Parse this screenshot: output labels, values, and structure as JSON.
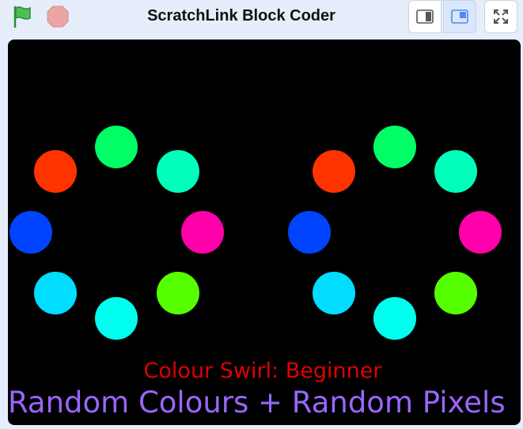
{
  "header": {
    "title": "ScratchLink Block Coder",
    "green_flag_icon": "green-flag-icon",
    "stop_icon": "stop-icon",
    "view_buttons": [
      {
        "name": "small-stage-button",
        "icon": "small-stage-icon"
      },
      {
        "name": "large-stage-button",
        "icon": "large-stage-icon",
        "active": true
      },
      {
        "name": "fullscreen-button",
        "icon": "fullscreen-icon"
      }
    ]
  },
  "stage": {
    "background": "#000000",
    "subtitle": "Colour Swirl: Beginner",
    "headline": "Random Colours + Random Pixels",
    "subtitle_color": "#e00000",
    "headline_color": "#9966ff",
    "swirls": [
      {
        "dots": [
          {
            "color": "#ff3300"
          },
          {
            "color": "#00ff66"
          },
          {
            "color": "#00ffbb"
          },
          {
            "color": "#0044ff"
          },
          {
            "color": "#ff00aa"
          },
          {
            "color": "#00ddff"
          },
          {
            "color": "#00ffee"
          },
          {
            "color": "#55ff00"
          }
        ]
      },
      {
        "dots": [
          {
            "color": "#ff3300"
          },
          {
            "color": "#00ff66"
          },
          {
            "color": "#00ffbb"
          },
          {
            "color": "#0044ff"
          },
          {
            "color": "#ff00aa"
          },
          {
            "color": "#00ddff"
          },
          {
            "color": "#00ffee"
          },
          {
            "color": "#55ff00"
          }
        ]
      }
    ]
  }
}
